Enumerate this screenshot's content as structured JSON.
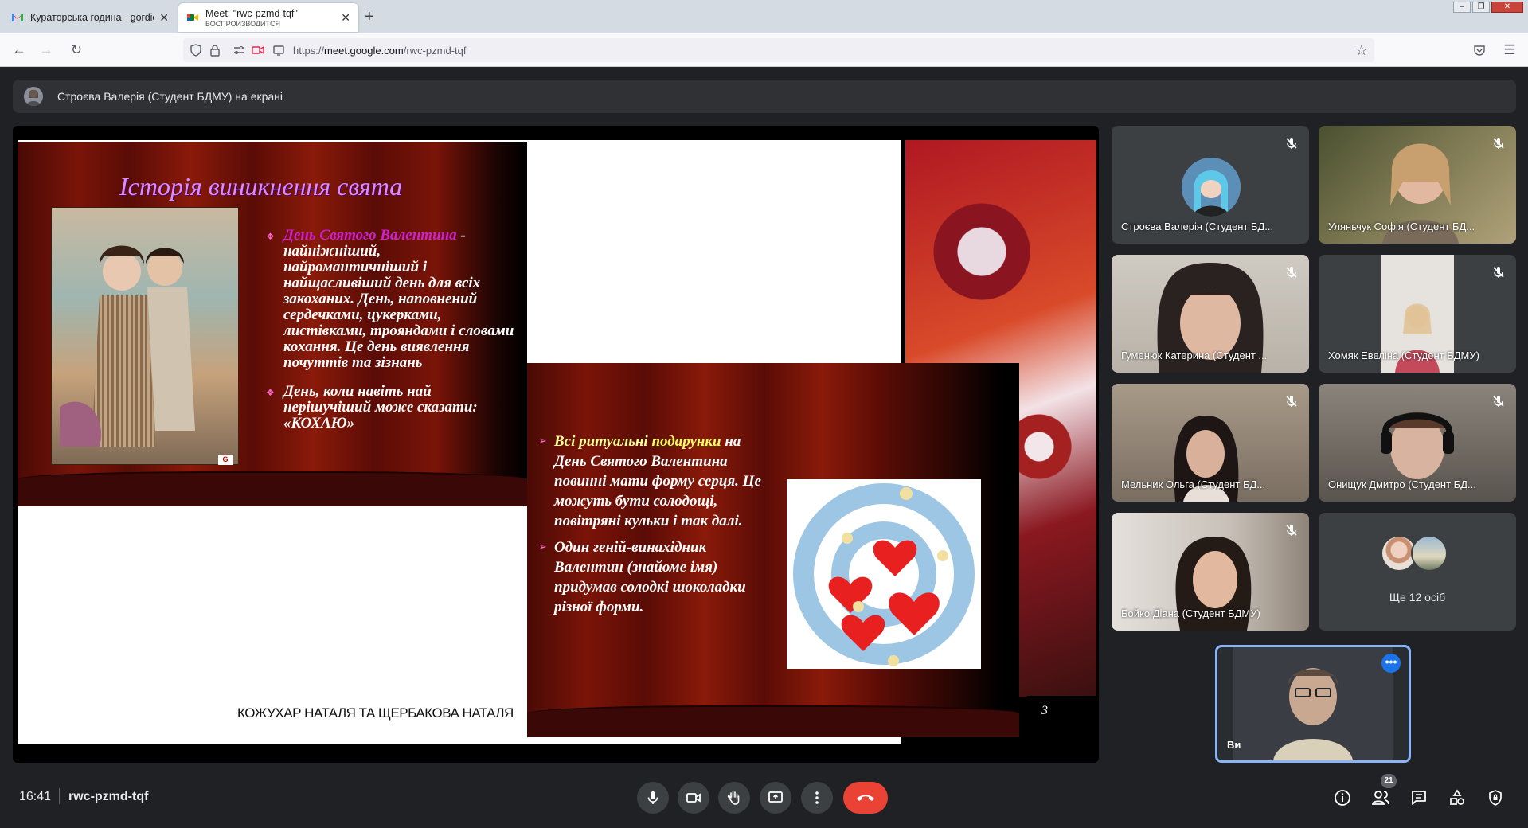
{
  "browser": {
    "tabs": [
      {
        "label": "Кураторська година - gordienk",
        "active": false
      },
      {
        "label": "Meet: \"rwc-pzmd-tqf\"",
        "sublabel": "ВОСПРОИЗВОДИТСЯ",
        "active": true
      }
    ],
    "url_host": "meet.google.com",
    "url_prefix": "https://",
    "url_path": "/rwc-pzmd-tqf"
  },
  "meet": {
    "presenter_text": "Строєва Валерія (Студент БДМУ) на екрані",
    "slide1": {
      "title": "Історія виникнення свята",
      "highlight": "День Святого Валентина",
      "body1": " - найніжніший, найромантичніший і найщасливіший  день для всіх закоханих. День, наповнений сердечками, цукерками, листівками, трояндами і словами кохання. Це день виявлення почуттів  та зізнань",
      "body2": "День, коли навіть най нерішучіший може сказати: «КОХАЮ»"
    },
    "slide2": {
      "b1_pre": "Всі ритуальні ",
      "b1_link": "подарунки",
      "b1_post": " на День Святого Валентина повинні мати форму серця. Це можуть бути солодощі, повітряні кульки і так далі.",
      "b2": "Один геній-винахідник Валентин (знайоме імя) придумав солодкі шоколадки різної форми."
    },
    "authors": "КОЖУХАР НАТАЛЯ  ТА ЩЕРБАКОВА НАТАЛЯ",
    "slide3_number": "3",
    "participants": [
      "Строєва Валерія (Студент БД...",
      "Уляньчук Софія (Студент БД...",
      "Гуменюк Катерина (Студент ...",
      "Хомяк Евеліна (Студент БДМУ)",
      "Мельник Ольга (Студент БД...",
      "Онищук Дмитро (Студент БД...",
      "Бойко Діана (Студент БДМУ)"
    ],
    "more_people": "Ще 12 осіб",
    "self_label": "Ви",
    "time": "16:41",
    "meeting_code": "rwc-pzmd-tqf",
    "participant_count": "21",
    "colors": {
      "accent": "#8ab4f8",
      "end_call": "#ea4335",
      "bg": "#202124"
    }
  }
}
